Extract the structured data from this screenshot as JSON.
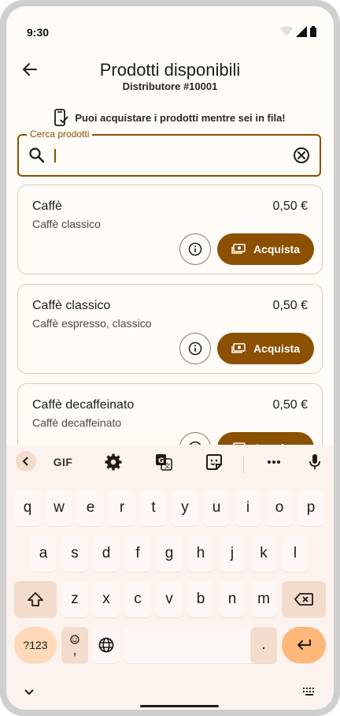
{
  "status_bar": {
    "time": "9:30"
  },
  "app_bar": {
    "title": "Prodotti disponibili",
    "subtitle": "Distributore #10001",
    "back_icon": "arrow-back-icon"
  },
  "info_message": "Puoi acquistare i prodotti mentre sei in fila!",
  "search": {
    "label": "Cerca prodotti",
    "value": "",
    "placeholder": ""
  },
  "products": [
    {
      "name": "Caffè",
      "description": "Caffè classico",
      "price": "0,50 €",
      "buy_label": "Acquista"
    },
    {
      "name": "Caffè classico",
      "description": "Caffè espresso, classico",
      "price": "0,50 €",
      "buy_label": "Acquista"
    },
    {
      "name": "Caffè decaffeinato",
      "description": "Caffè decaffeinato",
      "price": "0,50 €",
      "buy_label": "Acquista"
    }
  ],
  "keyboard": {
    "toolbar": {
      "gif": "GIF"
    },
    "rows": [
      [
        "q",
        "w",
        "e",
        "r",
        "t",
        "y",
        "u",
        "i",
        "o",
        "p"
      ],
      [
        "a",
        "s",
        "d",
        "f",
        "g",
        "h",
        "j",
        "k",
        "l"
      ],
      [
        "z",
        "x",
        "c",
        "v",
        "b",
        "n",
        "m"
      ]
    ],
    "symbols_key": "?123",
    "comma_key": ",",
    "period_key": "."
  },
  "colors": {
    "primary": "#8b5000",
    "background": "#fffbf7",
    "keyboard_bg": "#fcf3ee"
  }
}
